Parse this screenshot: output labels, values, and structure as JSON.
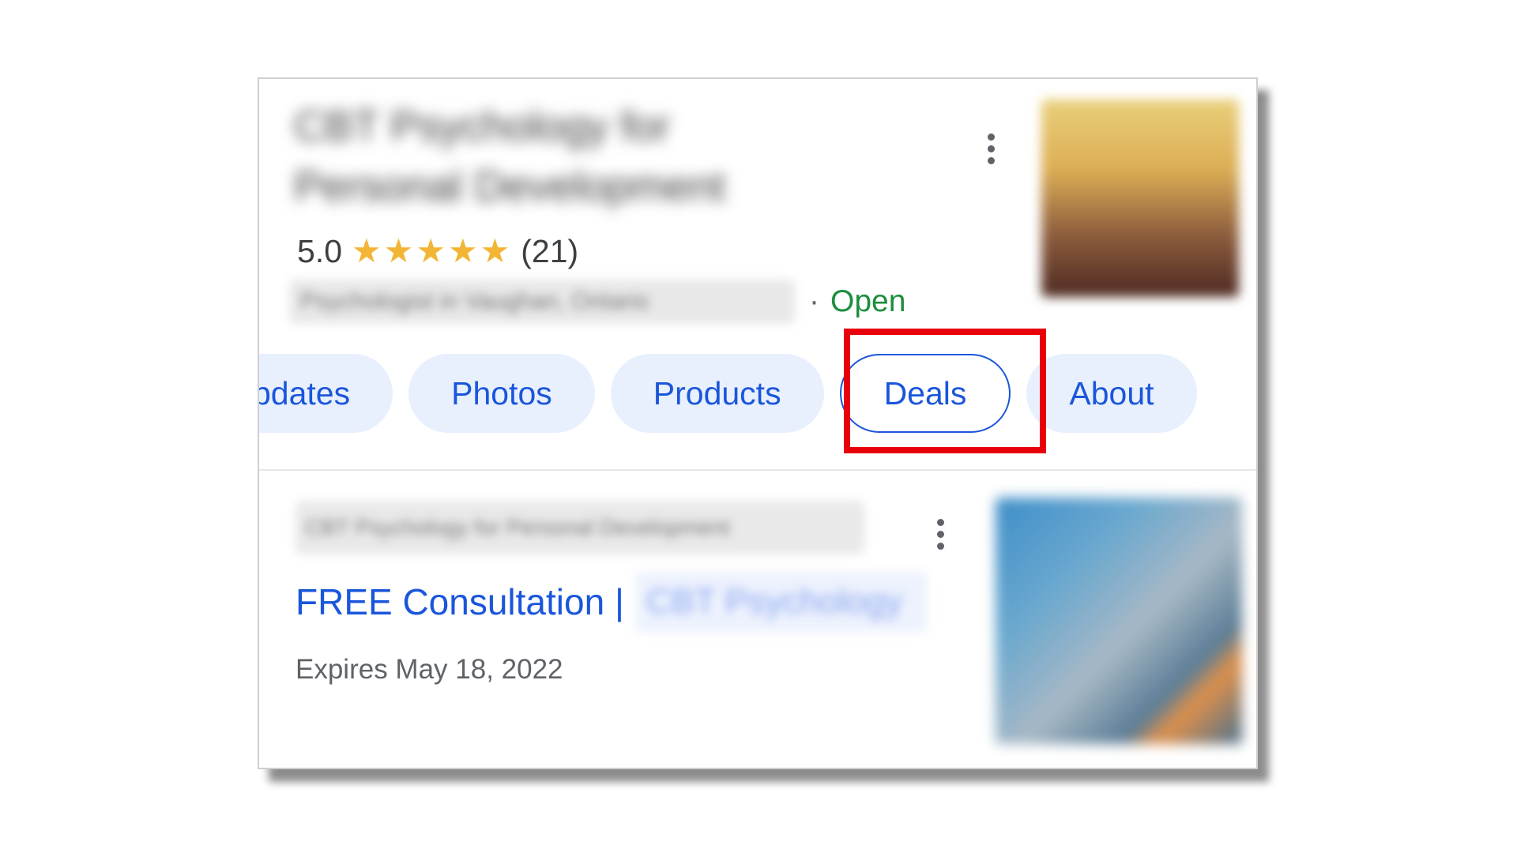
{
  "listing": {
    "name": "CBT Psychology for Personal Development",
    "rating": "5.0",
    "stars": [
      "★",
      "★",
      "★",
      "★",
      "★"
    ],
    "review_count": "(21)",
    "category": "Psychologist in Vaughan, Ontario",
    "separator": "·",
    "status": "Open",
    "status_color": "#1e8e3e"
  },
  "tabs": [
    {
      "label": "pdates"
    },
    {
      "label": "Photos"
    },
    {
      "label": "Products"
    },
    {
      "label": "Deals"
    },
    {
      "label": "About"
    }
  ],
  "active_tab": "Deals",
  "highlight_color": "#e8000b",
  "deal": {
    "source": "CBT Psychology for Personal Development",
    "title": "FREE Consultation |",
    "title_suffix": "CBT Psychology",
    "expiry": "Expires May 18, 2022"
  },
  "icons": {
    "more": "more-vert-icon",
    "star": "star-icon"
  },
  "colors": {
    "link_blue": "#1a56db",
    "chip_bg": "#e8f0fe",
    "star_gold": "#f2b534"
  }
}
